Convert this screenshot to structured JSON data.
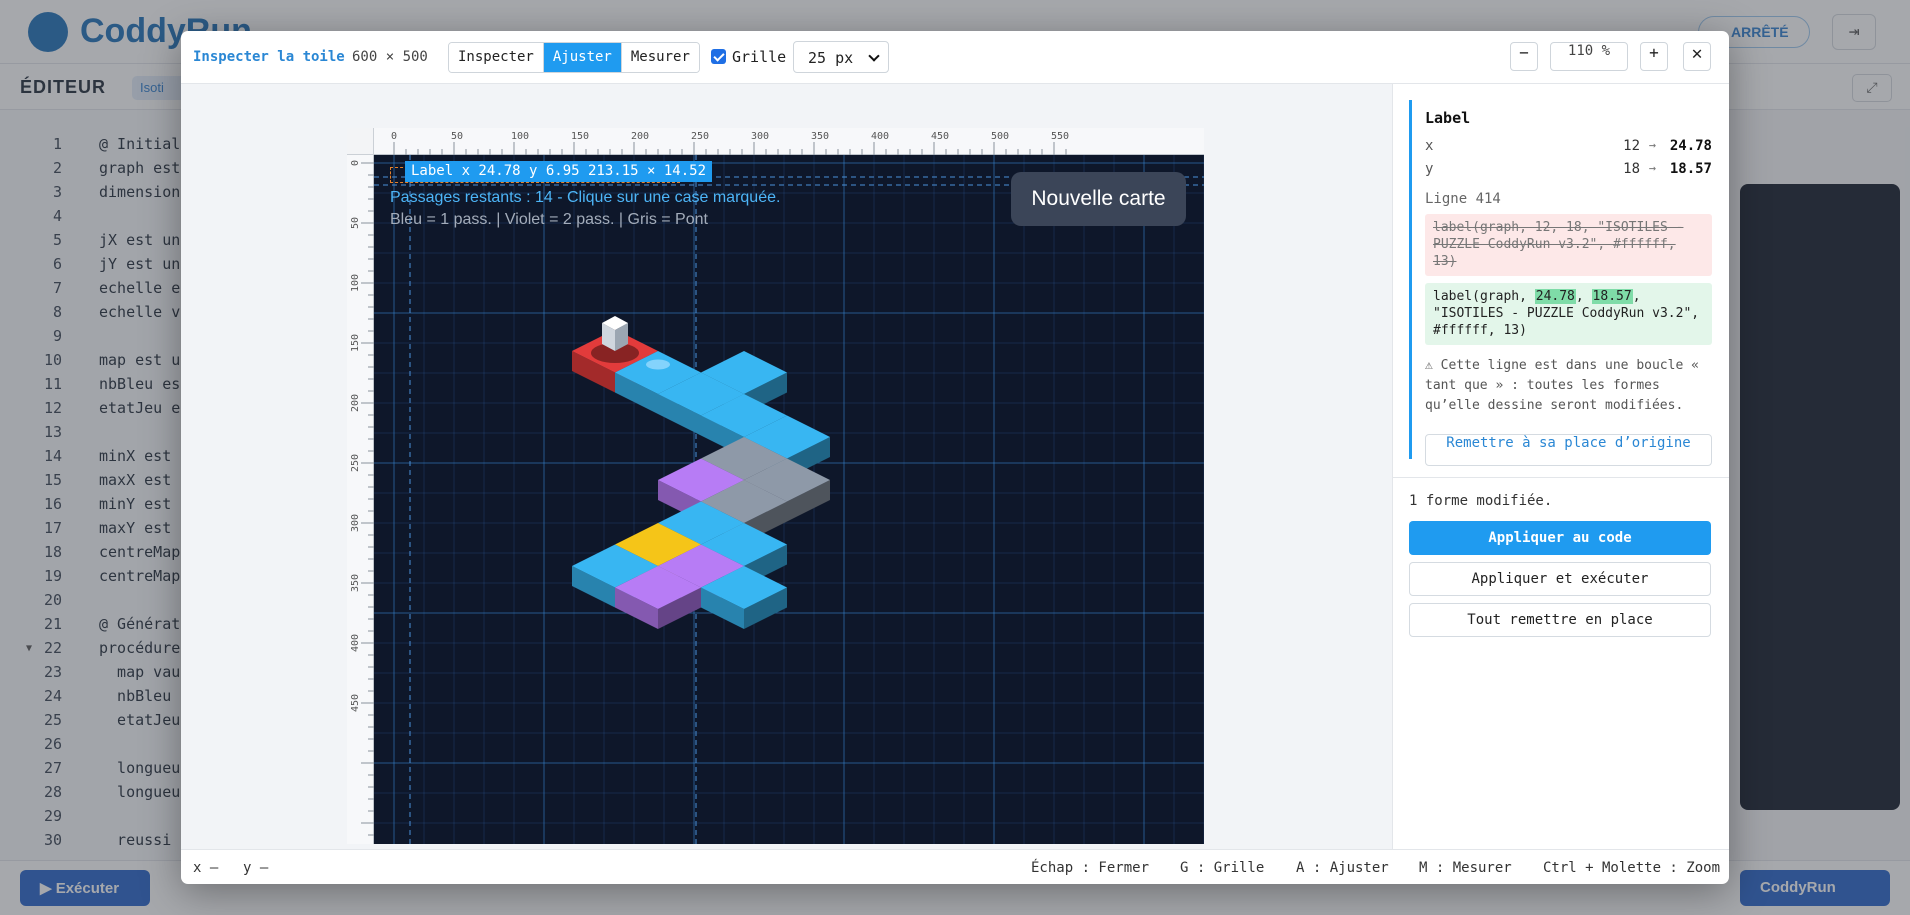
{
  "background": {
    "brand": "CoddyRun",
    "status": "ARRÊTÉ",
    "editor_label": "ÉDITEUR",
    "chip": "Isoti",
    "run_button": "Exécuter",
    "codyrun_button": "CoddyRun",
    "code_lines": [
      {
        "n": "1",
        "t": "@ Initial"
      },
      {
        "n": "2",
        "t": "graph est"
      },
      {
        "n": "3",
        "t": "dimension"
      },
      {
        "n": "4",
        "t": ""
      },
      {
        "n": "5",
        "t": "jX est un"
      },
      {
        "n": "6",
        "t": "jY est un"
      },
      {
        "n": "7",
        "t": "echelle e"
      },
      {
        "n": "8",
        "t": "echelle v"
      },
      {
        "n": "9",
        "t": ""
      },
      {
        "n": "10",
        "t": "map est u"
      },
      {
        "n": "11",
        "t": "nbBleu es"
      },
      {
        "n": "12",
        "t": "etatJeu e"
      },
      {
        "n": "13",
        "t": ""
      },
      {
        "n": "14",
        "t": "minX est"
      },
      {
        "n": "15",
        "t": "maxX est"
      },
      {
        "n": "16",
        "t": "minY est"
      },
      {
        "n": "17",
        "t": "maxY est"
      },
      {
        "n": "18",
        "t": "centreMap"
      },
      {
        "n": "19",
        "t": "centreMap"
      },
      {
        "n": "20",
        "t": ""
      },
      {
        "n": "21",
        "t": "@ Générat"
      },
      {
        "n": "22",
        "t": "procédure"
      },
      {
        "n": "23",
        "t": "  map vau"
      },
      {
        "n": "24",
        "t": "  nbBleu"
      },
      {
        "n": "25",
        "t": "  etatJeu"
      },
      {
        "n": "26",
        "t": ""
      },
      {
        "n": "27",
        "t": "  longueu"
      },
      {
        "n": "28",
        "t": "  longueu"
      },
      {
        "n": "29",
        "t": ""
      },
      {
        "n": "30",
        "t": "  reussi"
      }
    ]
  },
  "header": {
    "title": "Inspecter la toile",
    "dims": "600 × 500",
    "modes": [
      {
        "label": "Inspecter",
        "active": false
      },
      {
        "label": "Ajuster",
        "active": true
      },
      {
        "label": "Mesurer",
        "active": false
      }
    ],
    "grid_label": "Grille",
    "grid_checked": true,
    "grid_size": "25 px",
    "zoom_minus": "−",
    "zoom_level": "110 %",
    "zoom_plus": "+",
    "close": "✕"
  },
  "rulers": {
    "h_ticks": [
      "0",
      "50",
      "100",
      "150",
      "200",
      "250",
      "300",
      "350",
      "400",
      "450",
      "500",
      "550"
    ],
    "v_ticks": [
      "0",
      "50",
      "100",
      "150",
      "200",
      "250",
      "300",
      "350",
      "400",
      "450"
    ]
  },
  "canvas": {
    "selection_tag": "Label x 24.78 y 6.95 213.15 × 14.52",
    "line1": "Passages restants : 14 - Clique sur une case marquée.",
    "line2": "Bleu = 1 pass. | Violet = 2 pass. | Gris = Pont",
    "new_map": "Nouvelle carte",
    "colors": {
      "background": "#0e172a",
      "blue": "#38b6f2",
      "violet": "#b77cf5",
      "grey": "#8e99a8",
      "yellow": "#f5c518",
      "red": "#e23b3b"
    }
  },
  "side": {
    "title": "Label",
    "props": [
      {
        "key": "x",
        "old": "12",
        "new": "24.78"
      },
      {
        "key": "y",
        "old": "18",
        "new": "18.57"
      }
    ],
    "arrow": "→",
    "line_ref": "Ligne 414",
    "code_old": "label(graph, 12, 18, \"ISOTILES - PUZZLE CoddyRun v3.2\", #ffffff, 13)",
    "code_new_prefix": "label(graph, ",
    "code_new_x": "24.78",
    "code_new_sep": ", ",
    "code_new_y": "18.57",
    "code_new_suffix": ", \"ISOTILES - PUZZLE CoddyRun v3.2\", #ffffff, 13)",
    "warning": "⚠ Cette ligne est dans une boucle « tant que » : toutes les formes qu’elle dessine seront modifiées.",
    "reset_one": "Remettre à sa place d’origine",
    "modified_count": "1 forme modifiée.",
    "apply": "Appliquer au code",
    "apply_run": "Appliquer et exécuter",
    "reset_all": "Tout remettre en place"
  },
  "footer": {
    "x": "x –",
    "y": "y –",
    "hints": [
      "Échap : Fermer",
      "G : Grille",
      "A : Ajuster",
      "M : Mesurer",
      "Ctrl + Molette : Zoom"
    ]
  }
}
